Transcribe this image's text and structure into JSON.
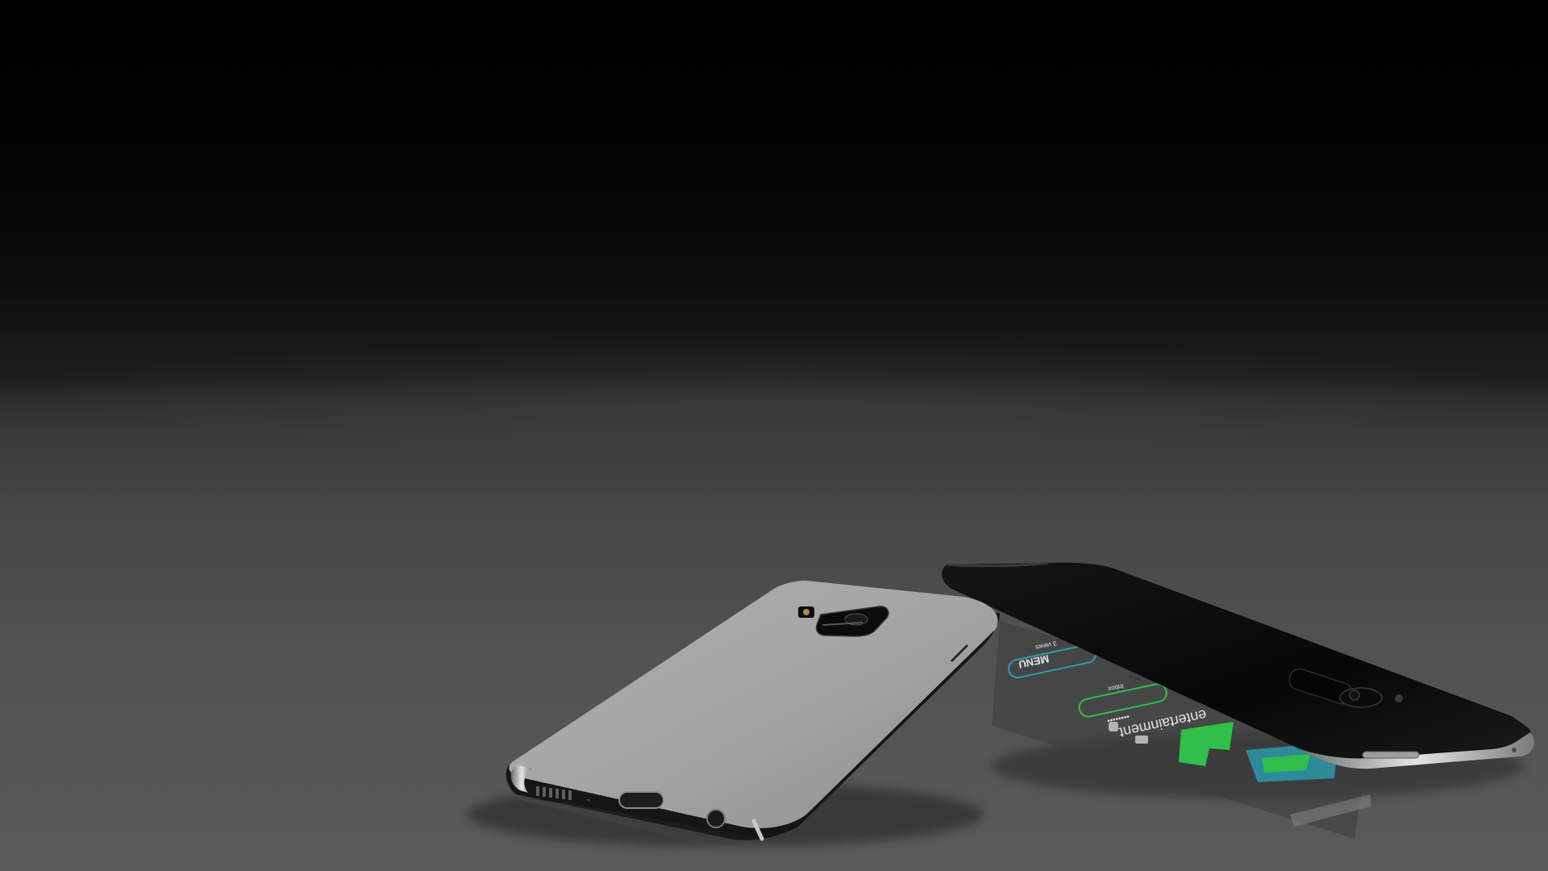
{
  "scene": {
    "description_type": "product-render",
    "background_colors": {
      "top": "#000000",
      "floor": "#555555"
    },
    "silver_phone": {
      "body_color": "#a3a3a3",
      "frame_color": "#1a1a1a"
    },
    "black_phone": {
      "body_color": "#0c0c0c",
      "frame_color": "#b9b9b9"
    },
    "screen_reflection": {
      "accent_green": "#2fbf4a",
      "accent_teal": "#2a9fb0",
      "texts": {
        "header": "MENU",
        "label_small": "3 views",
        "label_mid": "Inbox",
        "password_mask": "••••••••",
        "word": "entertainment"
      }
    }
  }
}
